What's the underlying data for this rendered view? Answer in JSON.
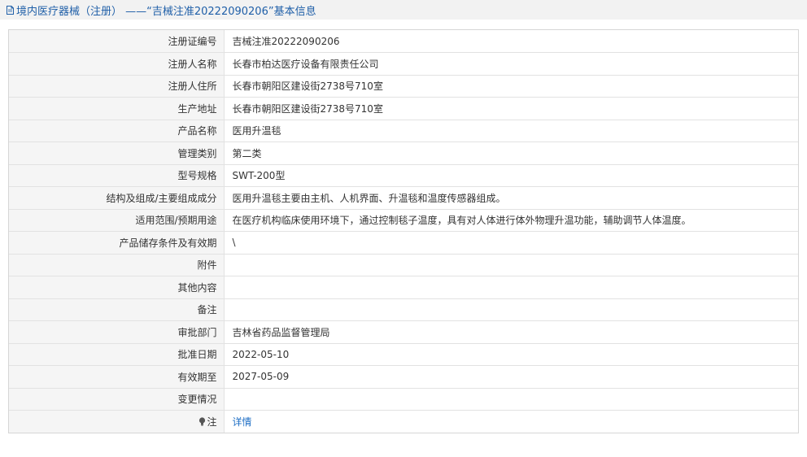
{
  "header": {
    "title": "境内医疗器械（注册）  ——“吉械注准20222090206”基本信息",
    "doc_icon": "document-icon"
  },
  "rows": [
    {
      "label": "注册证编号",
      "value": "吉械注准20222090206"
    },
    {
      "label": "注册人名称",
      "value": "长春市柏达医疗设备有限责任公司"
    },
    {
      "label": "注册人住所",
      "value": "长春市朝阳区建设街2738号710室"
    },
    {
      "label": "生产地址",
      "value": "长春市朝阳区建设街2738号710室"
    },
    {
      "label": "产品名称",
      "value": "医用升温毯"
    },
    {
      "label": "管理类别",
      "value": "第二类"
    },
    {
      "label": "型号规格",
      "value": "SWT-200型"
    },
    {
      "label": "结构及组成/主要组成成分",
      "value": "医用升温毯主要由主机、人机界面、升温毯和温度传感器组成。"
    },
    {
      "label": "适用范围/预期用途",
      "value": "在医疗机构临床使用环境下，通过控制毯子温度，具有对人体进行体外物理升温功能，辅助调节人体温度。"
    },
    {
      "label": "产品储存条件及有效期",
      "value": "\\"
    },
    {
      "label": "附件",
      "value": ""
    },
    {
      "label": "其他内容",
      "value": ""
    },
    {
      "label": "备注",
      "value": ""
    },
    {
      "label": "审批部门",
      "value": "吉林省药品监督管理局"
    },
    {
      "label": "批准日期",
      "value": "2022-05-10"
    },
    {
      "label": "有效期至",
      "value": "2027-05-09"
    },
    {
      "label": "变更情况",
      "value": ""
    }
  ],
  "note_row": {
    "label": "注",
    "icon": "lightbulb-icon",
    "link_text": "详情"
  },
  "colors": {
    "header_bg": "#f2f2f2",
    "header_text": "#1f5fa8",
    "label_bg": "#f5f5f5",
    "link": "#1f6fc5"
  }
}
